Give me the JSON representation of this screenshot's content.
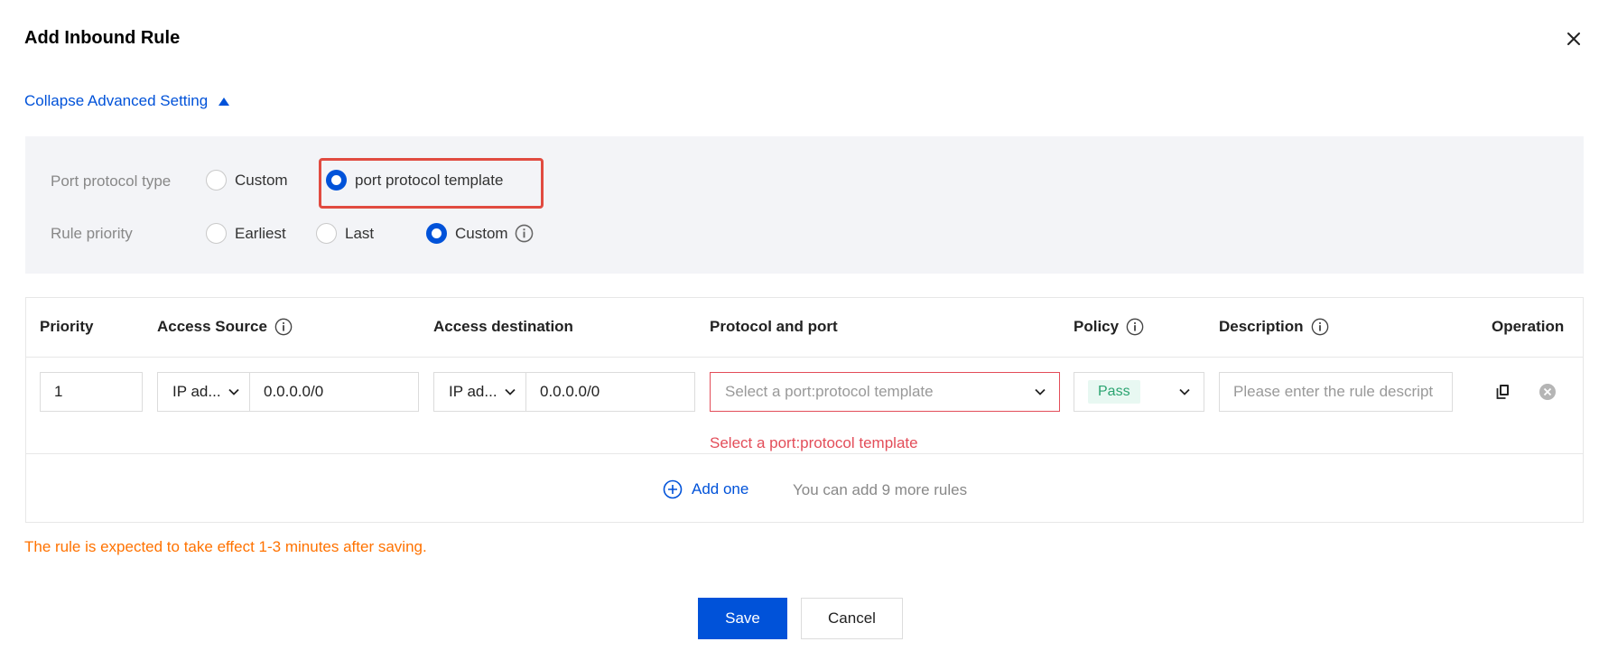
{
  "dialog": {
    "title": "Add Inbound Rule",
    "collapse_label": "Collapse Advanced Setting"
  },
  "advanced": {
    "port_protocol_type": {
      "label": "Port protocol type",
      "options": [
        "Custom",
        "port protocol template"
      ],
      "selected": "port protocol template"
    },
    "rule_priority": {
      "label": "Rule priority",
      "options": [
        "Earliest",
        "Last",
        "Custom"
      ],
      "selected": "Custom"
    }
  },
  "table": {
    "headers": {
      "priority": "Priority",
      "access_source": "Access Source",
      "access_destination": "Access destination",
      "protocol_port": "Protocol and port",
      "policy": "Policy",
      "description": "Description",
      "operation": "Operation"
    },
    "row": {
      "priority": "1",
      "source_type": "IP ad...",
      "source_value": "0.0.0.0/0",
      "dest_type": "IP ad...",
      "dest_value": "0.0.0.0/0",
      "protocol_placeholder": "Select a port:protocol template",
      "protocol_error": "Select a port:protocol template",
      "policy": "Pass",
      "description_placeholder": "Please enter the rule descript"
    },
    "add_label": "Add one",
    "remaining_text": "You can add 9 more rules"
  },
  "notice": "The rule is expected to take effect 1-3 minutes after saving.",
  "buttons": {
    "save": "Save",
    "cancel": "Cancel"
  },
  "colors": {
    "primary": "#0052d9",
    "error": "#e34d59",
    "warning": "#ff7200",
    "success": "#2ba471",
    "highlight": "#e14b40"
  }
}
